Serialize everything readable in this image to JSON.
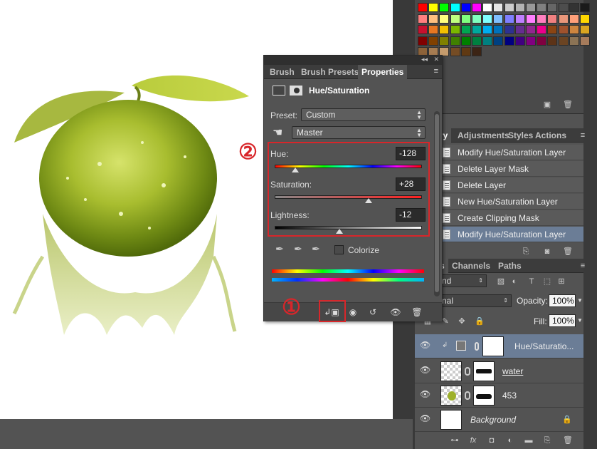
{
  "properties_panel": {
    "tabs": [
      "Brush",
      "Brush Presets",
      "Properties"
    ],
    "active_tab": "Properties",
    "title": "Hue/Saturation",
    "preset_label": "Preset:",
    "preset_value": "Custom",
    "channel_value": "Master",
    "hue_label": "Hue:",
    "hue_value": "-128",
    "hue_level": 0.14,
    "saturation_label": "Saturation:",
    "saturation_value": "+28",
    "saturation_level": 0.64,
    "lightness_label": "Lightness:",
    "lightness_value": "-12",
    "lightness_level": 0.44,
    "colorize_label": "Colorize",
    "colorize_checked": false
  },
  "annotations": {
    "marker_1": "①",
    "marker_2": "②",
    "marker_color": "#d8262a"
  },
  "history_panel": {
    "tabs": [
      "ry",
      "Adjustments",
      "Styles",
      "Actions"
    ],
    "items": [
      "Modify Hue/Saturation Layer",
      "Delete Layer Mask",
      "Delete Layer",
      "New Hue/Saturation Layer",
      "Create Clipping Mask",
      "Modify Hue/Saturation Layer"
    ],
    "selected_index": 5
  },
  "layers_panel": {
    "tabs": [
      "s",
      "Channels",
      "Paths"
    ],
    "filter_kind": "nd",
    "blend_mode": "nal",
    "opacity_label": "Opacity:",
    "opacity_value": "100%",
    "fill_label": "Fill:",
    "fill_value": "100%",
    "layers": [
      {
        "name": "Hue/Saturatio...",
        "selected": true
      },
      {
        "name": "water",
        "selected": false
      },
      {
        "name": "453",
        "selected": false
      },
      {
        "name": "Background",
        "selected": false
      }
    ]
  },
  "icons": [
    "adjustment-icon",
    "mask-icon",
    "targeted-adjustment-icon",
    "eyedropper-icon",
    "eyedropper-plus-icon",
    "eyedropper-minus-icon",
    "clip-to-layer-icon",
    "view-previous-icon",
    "reset-icon",
    "visibility-icon",
    "trash-icon",
    "lock-icon",
    "link-icon",
    "fx-icon",
    "new-layer-icon",
    "folder-icon",
    "camera-icon"
  ]
}
